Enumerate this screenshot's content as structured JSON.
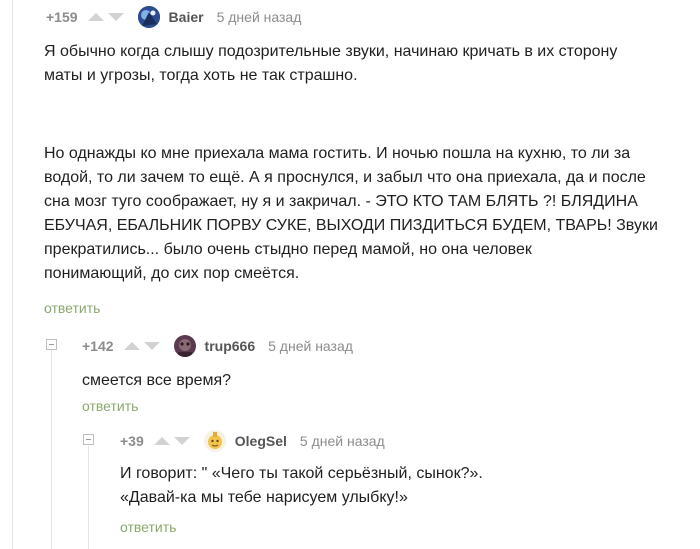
{
  "comments": [
    {
      "rating": "+159",
      "author": "Baier",
      "time": "5 дней назад",
      "text_lines": [
        "Я обычно когда слышу подозрительные звуки, начинаю кричать в их сторону",
        "маты и угрозы, тогда хоть не так страшно."
      ],
      "text_lines_2": [
        "Но однажды ко мне приехала мама гостить. И ночью пошла на кухню, то ли за",
        "водой, то ли зачем то ещё. А я проснулся, и забыл что она приехала, да и после",
        "сна мозг туго соображает, ну я и закричал. - ЭТО КТО ТАМ БЛЯТЬ ?! БЛЯДИНА",
        "ЕБУЧАЯ, ЕБАЛЬНИК ПОРВУ СУКЕ, ВЫХОДИ ПИЗДИТЬСЯ БУДЕМ, ТВАРЬ! Звуки",
        "прекратились... было очень стыдно перед мамой, но она человек",
        "понимающий, до сих пор смеётся."
      ],
      "reply_label": "ответить"
    },
    {
      "rating": "+142",
      "author": "trup666",
      "time": "5 дней назад",
      "text_lines": [
        "смеется все время?"
      ],
      "reply_label": "ответить"
    },
    {
      "rating": "+39",
      "author": "OlegSel",
      "time": "5 дней назад",
      "text_lines": [
        "И говорит: \" «Чего ты такой серьёзный, сынок?».",
        "«Давай-ка мы тебе нарисуем улыбку!»"
      ],
      "reply_label": "ответить"
    }
  ],
  "colors": {
    "rating": "#8c8c8c",
    "author": "#555555",
    "reply_link": "#8ba86b",
    "thread_line": "#e3e3e3"
  }
}
